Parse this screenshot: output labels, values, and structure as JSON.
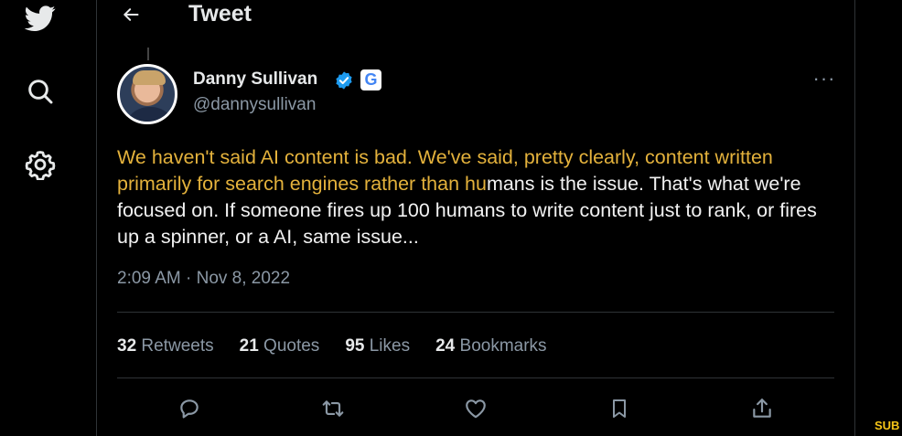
{
  "header": {
    "title": "Tweet"
  },
  "tweet": {
    "display_name": "Danny Sullivan",
    "handle": "@dannysullivan",
    "google_badge": "G",
    "more_label": "···",
    "text_highlighted": "We haven't said AI content is bad. We've said, pretty clearly, content written primarily for search engines rather than hu",
    "text_plain": "mans is the issue. That's what we're focused on. If someone fires up 100 humans to write content just to rank, or fires up a spinner, or a AI, same issue...",
    "timestamp": "2:09 AM · Nov 8, 2022"
  },
  "stats": {
    "retweets_count": "32",
    "retweets_label": "Retweets",
    "quotes_count": "21",
    "quotes_label": "Quotes",
    "likes_count": "95",
    "likes_label": "Likes",
    "bookmarks_count": "24",
    "bookmarks_label": "Bookmarks"
  },
  "edge_text": "SUB",
  "colors": {
    "highlight": "#e4b23c",
    "verified": "#1d9bf0",
    "muted": "#8b98a5"
  },
  "icons": {
    "sidebar": [
      "twitter-logo-icon",
      "search-icon",
      "settings-icon"
    ],
    "actions": [
      "reply-icon",
      "retweet-icon",
      "like-icon",
      "bookmark-icon",
      "share-icon"
    ]
  }
}
